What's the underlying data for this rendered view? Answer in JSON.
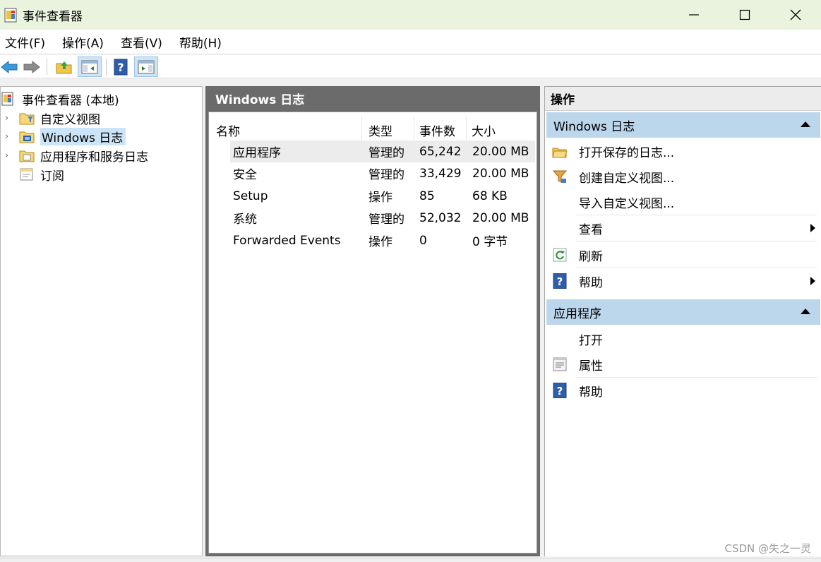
{
  "window": {
    "title": "事件查看器"
  },
  "menu": [
    "文件(F)",
    "操作(A)",
    "查看(V)",
    "帮助(H)"
  ],
  "tree": {
    "root": "事件查看器 (本地)",
    "items": [
      {
        "label": "自定义视图",
        "icon": "custom-view-folder-icon"
      },
      {
        "label": "Windows 日志",
        "icon": "windows-log-folder-icon",
        "selected": true
      },
      {
        "label": "应用程序和服务日志",
        "icon": "app-services-folder-icon"
      },
      {
        "label": "订阅",
        "icon": "subscription-icon"
      }
    ]
  },
  "middle": {
    "header": "Windows 日志",
    "columns": [
      "名称",
      "类型",
      "事件数",
      "大小"
    ],
    "rows": [
      {
        "name": "应用程序",
        "type": "管理的",
        "count": "65,242",
        "size": "20.00 MB"
      },
      {
        "name": "安全",
        "type": "管理的",
        "count": "33,429",
        "size": "20.00 MB"
      },
      {
        "name": "Setup",
        "type": "操作",
        "count": "85",
        "size": "68 KB"
      },
      {
        "name": "系统",
        "type": "管理的",
        "count": "52,032",
        "size": "20.00 MB"
      },
      {
        "name": "Forwarded Events",
        "type": "操作",
        "count": "0",
        "size": "0 字节"
      }
    ]
  },
  "actions": {
    "title": "操作",
    "section1": {
      "header": "Windows 日志",
      "items": [
        "打开保存的日志...",
        "创建自定义视图...",
        "导入自定义视图...",
        "查看",
        "刷新",
        "帮助"
      ]
    },
    "section2": {
      "header": "应用程序",
      "items": [
        "打开",
        "属性",
        "帮助"
      ]
    }
  },
  "watermark": "CSDN @失之一灵",
  "colors": {
    "title_bg": "#e9f3de",
    "selection": "#cce4f7",
    "section_bg": "#bcd6ec",
    "mid_header": "#6b6b6b"
  }
}
